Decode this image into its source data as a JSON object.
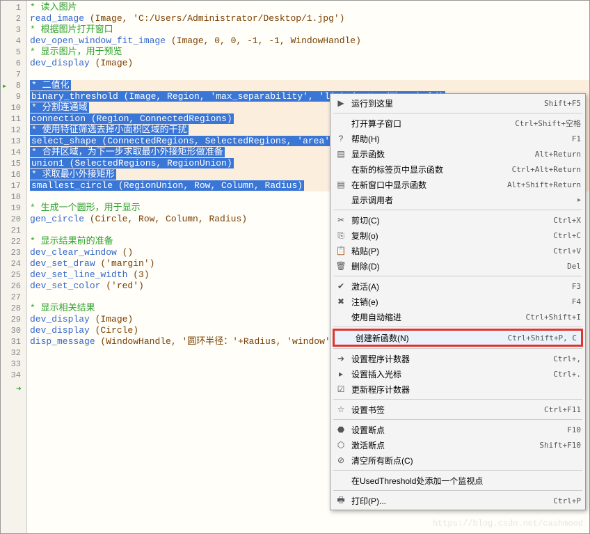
{
  "code": [
    {
      "n": 1,
      "type": "comment",
      "text": "* 读入图片"
    },
    {
      "n": 2,
      "type": "code",
      "fn": "read_image",
      "args": " (Image, 'C:/Users/Administrator/Desktop/1.jpg')"
    },
    {
      "n": 3,
      "type": "comment",
      "text": "* 根据图片打开窗口"
    },
    {
      "n": 4,
      "type": "code",
      "fn": "dev_open_window_fit_image",
      "args": " (Image, 0, 0, -1, -1, WindowHandle)"
    },
    {
      "n": 5,
      "type": "comment",
      "text": "* 显示图片，用于预览"
    },
    {
      "n": 6,
      "type": "code",
      "fn": "dev_display",
      "args": " (Image)"
    },
    {
      "n": 7,
      "type": "blank",
      "text": ""
    },
    {
      "n": 8,
      "type": "sel-comment",
      "text": "* 二值化"
    },
    {
      "n": 9,
      "type": "sel-code",
      "text": "binary_threshold (Image, Region, 'max_separability', 'light', UsedThreshold)"
    },
    {
      "n": 10,
      "type": "sel-comment",
      "text": "* 分割连通域"
    },
    {
      "n": 11,
      "type": "sel-code",
      "text": "connection (Region, ConnectedRegions)"
    },
    {
      "n": 12,
      "type": "sel-comment",
      "text": "* 使用特征筛选去掉小面积区域的干扰"
    },
    {
      "n": 13,
      "type": "sel-code",
      "text": "select_shape (ConnectedRegions, SelectedRegions, 'area', 'and'"
    },
    {
      "n": 14,
      "type": "sel-comment",
      "text": "* 合并区域，为下一步求取最小外接矩形做准备"
    },
    {
      "n": 15,
      "type": "sel-code",
      "text": "union1 (SelectedRegions, RegionUnion)"
    },
    {
      "n": 16,
      "type": "sel-comment",
      "text": "* 求取最小外接矩形"
    },
    {
      "n": 17,
      "type": "sel-code",
      "text": "smallest_circle (RegionUnion, Row, Column, Radius)"
    },
    {
      "n": 18,
      "type": "blank",
      "text": ""
    },
    {
      "n": 19,
      "type": "comment",
      "text": "* 生成一个圆形，用于显示"
    },
    {
      "n": 20,
      "type": "code",
      "fn": "gen_circle",
      "args": " (Circle, Row, Column, Radius)"
    },
    {
      "n": 21,
      "type": "blank",
      "text": ""
    },
    {
      "n": 22,
      "type": "comment",
      "text": "* 显示结果前的准备"
    },
    {
      "n": 23,
      "type": "code",
      "fn": "dev_clear_window",
      "args": " ()"
    },
    {
      "n": 24,
      "type": "code",
      "fn": "dev_set_draw",
      "args": " ('margin')"
    },
    {
      "n": 25,
      "type": "code",
      "fn": "dev_set_line_width",
      "args": " (3)"
    },
    {
      "n": 26,
      "type": "code",
      "fn": "dev_set_color",
      "args": " ('red')"
    },
    {
      "n": 27,
      "type": "blank",
      "text": ""
    },
    {
      "n": 28,
      "type": "comment",
      "text": "* 显示相关结果"
    },
    {
      "n": 29,
      "type": "code",
      "fn": "dev_display",
      "args": " (Image)"
    },
    {
      "n": 30,
      "type": "code",
      "fn": "dev_display",
      "args": " (Circle)"
    },
    {
      "n": 31,
      "type": "code",
      "fn": "disp_message",
      "args": " (WindowHandle, '圆环半径：'+Radius, 'window', 50,"
    },
    {
      "n": 32,
      "type": "blank",
      "text": ""
    },
    {
      "n": 33,
      "type": "blank",
      "text": ""
    },
    {
      "n": 34,
      "type": "blank",
      "text": ""
    }
  ],
  "menu": {
    "sections": [
      [
        {
          "icon": "run",
          "label": "运行到这里",
          "shortcut": "Shift+F5"
        }
      ],
      [
        {
          "icon": "",
          "label": "打开算子窗口",
          "shortcut": "Ctrl+Shift+空格"
        },
        {
          "icon": "help",
          "label": "帮助(H)",
          "shortcut": "F1"
        },
        {
          "icon": "doc",
          "label": "显示函数",
          "shortcut": "Alt+Return"
        },
        {
          "icon": "",
          "label": "在新的标签页中显示函数",
          "shortcut": "Ctrl+Alt+Return"
        },
        {
          "icon": "doc",
          "label": "在新窗口中显示函数",
          "shortcut": "Alt+Shift+Return"
        },
        {
          "icon": "",
          "label": "显示调用者",
          "shortcut": "",
          "sub": "▸"
        }
      ],
      [
        {
          "icon": "cut",
          "label": "剪切(C)",
          "shortcut": "Ctrl+X"
        },
        {
          "icon": "copy",
          "label": "复制(o)",
          "shortcut": "Ctrl+C"
        },
        {
          "icon": "paste",
          "label": "粘贴(P)",
          "shortcut": "Ctrl+V"
        },
        {
          "icon": "delete",
          "label": "删除(D)",
          "shortcut": "Del"
        }
      ],
      [
        {
          "icon": "activate",
          "label": "激活(A)",
          "shortcut": "F3"
        },
        {
          "icon": "cancel",
          "label": "注销(e)",
          "shortcut": "F4"
        },
        {
          "icon": "",
          "label": "使用自动缩进",
          "shortcut": "Ctrl+Shift+I"
        }
      ],
      [
        {
          "icon": "",
          "label": "创建新函数(N)",
          "shortcut": "Ctrl+Shift+P, C",
          "highlighted": true
        }
      ],
      [
        {
          "icon": "arrow-r",
          "label": "设置程序计数器",
          "shortcut": "Ctrl+,"
        },
        {
          "icon": "tri-r",
          "label": "设置插入光标",
          "shortcut": "Ctrl+."
        },
        {
          "icon": "check",
          "label": "更新程序计数器",
          "shortcut": ""
        }
      ],
      [
        {
          "icon": "star",
          "label": "设置书签",
          "shortcut": "Ctrl+F11"
        }
      ],
      [
        {
          "icon": "stop",
          "label": "设置断点",
          "shortcut": "F10"
        },
        {
          "icon": "stop-gray",
          "label": "激活断点",
          "shortcut": "Shift+F10"
        },
        {
          "icon": "clear-bp",
          "label": "清空所有断点(C)",
          "shortcut": ""
        }
      ],
      [
        {
          "icon": "",
          "label": "在UsedThreshold处添加一个监视点",
          "shortcut": ""
        }
      ],
      [
        {
          "icon": "print",
          "label": "打印(P)...",
          "shortcut": "Ctrl+P"
        }
      ]
    ]
  },
  "watermark": "https://blog.csdn.net/cashmood",
  "breakpoint_line": 8,
  "arrow_line": 34
}
